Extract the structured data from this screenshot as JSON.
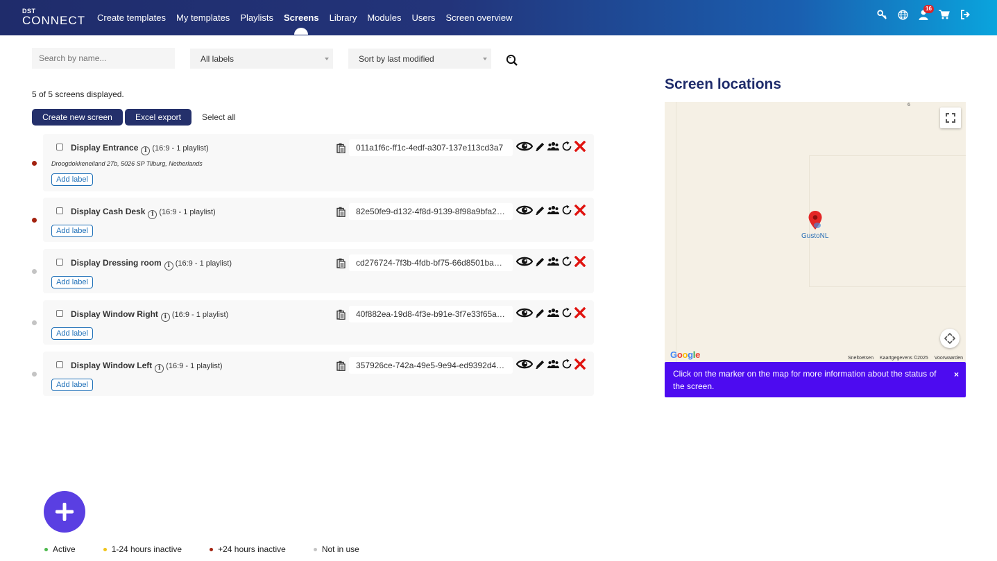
{
  "brand": {
    "small": "DST",
    "big": "CONNECT"
  },
  "nav": {
    "items": [
      {
        "label": "Create templates"
      },
      {
        "label": "My templates"
      },
      {
        "label": "Playlists"
      },
      {
        "label": "Screens",
        "active": true
      },
      {
        "label": "Library"
      },
      {
        "label": "Modules"
      },
      {
        "label": "Users"
      },
      {
        "label": "Screen overview"
      }
    ],
    "notification_count": "16",
    "icons": [
      "key-icon",
      "globe-icon",
      "user-icon",
      "cart-icon",
      "logout-icon"
    ]
  },
  "filters": {
    "search_placeholder": "Search by name...",
    "labels_value": "All labels",
    "sort_value": "Sort by last modified"
  },
  "summary": "5 of 5 screens displayed.",
  "toolbar": {
    "create_label": "Create new screen",
    "excel_label": "Excel export",
    "select_all_label": "Select all"
  },
  "colors": {
    "active": "#4cb84c",
    "inactive_short": "#f0c419",
    "inactive_long": "#a3220f",
    "not_in_use": "#c4c4c4",
    "primary": "#24306b",
    "delete": "#e0130f"
  },
  "screens": [
    {
      "name": "Display Entrance",
      "meta": "(16:9 - 1 playlist)",
      "address": "Droogdokkeneiland 27b, 5026 SP Tilburg, Netherlands",
      "uuid": "011a1f6c-ff1c-4edf-a307-137e113cd3a7",
      "status": "inactive_long",
      "add_label": "Add label"
    },
    {
      "name": "Display Cash Desk",
      "meta": "(16:9 - 1 playlist)",
      "address": "",
      "uuid": "82e50fe9-d132-4f8d-9139-8f98a9bfa2…",
      "status": "inactive_long",
      "add_label": "Add label"
    },
    {
      "name": "Display Dressing room",
      "meta": "(16:9 - 1 playlist)",
      "address": "",
      "uuid": "cd276724-7f3b-4fdb-bf75-66d8501ba…",
      "status": "not_in_use",
      "add_label": "Add label"
    },
    {
      "name": "Display Window Right",
      "meta": "(16:9 - 1 playlist)",
      "address": "",
      "uuid": "40f882ea-19d8-4f3e-b91e-3f7e33f65a…",
      "status": "not_in_use",
      "add_label": "Add label"
    },
    {
      "name": "Display Window Left",
      "meta": "(16:9 - 1 playlist)",
      "address": "",
      "uuid": "357926ce-742a-49e5-9e94-ed9392d4…",
      "status": "not_in_use",
      "add_label": "Add label"
    }
  ],
  "map": {
    "title": "Screen locations",
    "marker_label": "GustoNL",
    "corner_number": "6",
    "google_label": "Google",
    "attribution": [
      "Sneltoetsen",
      "Kaartgegevens ©2025",
      "Voorwaarden"
    ],
    "notice": "Click on the marker on the map for more information about the status of the screen.",
    "notice_close": "×"
  },
  "legend": [
    {
      "label": "Active",
      "color": "#4cb84c"
    },
    {
      "label": "1-24 hours inactive",
      "color": "#f0c419"
    },
    {
      "label": "+24 hours inactive",
      "color": "#a3220f"
    },
    {
      "label": "Not in use",
      "color": "#c4c4c4"
    }
  ]
}
